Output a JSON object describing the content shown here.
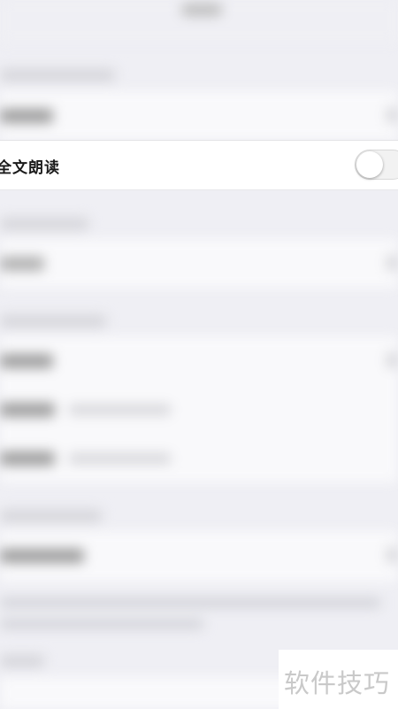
{
  "settings": {
    "full_text_read": {
      "label": "全文朗读",
      "enabled": false
    }
  },
  "watermark": {
    "text": "软件技巧"
  }
}
